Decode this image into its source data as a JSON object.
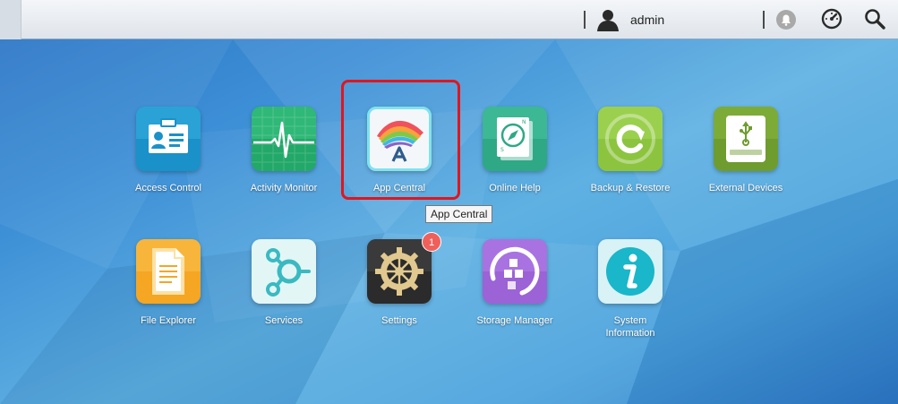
{
  "topbar": {
    "username": "admin",
    "icons": [
      "user-icon",
      "notification-bell-icon",
      "dashboard-gauge-icon",
      "search-icon"
    ]
  },
  "apps": [
    {
      "label": "Access Control",
      "icon": "id-card-icon",
      "color": "#1a91c8"
    },
    {
      "label": "Activity Monitor",
      "icon": "heartbeat-monitor-icon",
      "color": "#22a868"
    },
    {
      "label": "App Central",
      "icon": "app-central-icon",
      "color": "#ffffff"
    },
    {
      "label": "Online Help",
      "icon": "compass-book-icon",
      "color": "#2fa886"
    },
    {
      "label": "Backup & Restore",
      "icon": "backup-refresh-icon",
      "color": "#8cc43f"
    },
    {
      "label": "External Devices",
      "icon": "usb-drive-icon",
      "color": "#6f9c2e"
    },
    {
      "label": "File Explorer",
      "icon": "folder-document-icon",
      "color": "#f5a623"
    },
    {
      "label": "Services",
      "icon": "services-nodes-icon",
      "color": "#5cc7c8"
    },
    {
      "label": "Settings",
      "icon": "gear-icon",
      "color": "#2b2b2b",
      "badge": "1"
    },
    {
      "label": "Storage Manager",
      "icon": "storage-blocks-icon",
      "color": "#9b63d6"
    },
    {
      "label": "System\nInformation",
      "icon": "info-icon",
      "color": "#1ab6c9"
    }
  ],
  "tooltip": "App Central",
  "highlighted_app": "App Central"
}
